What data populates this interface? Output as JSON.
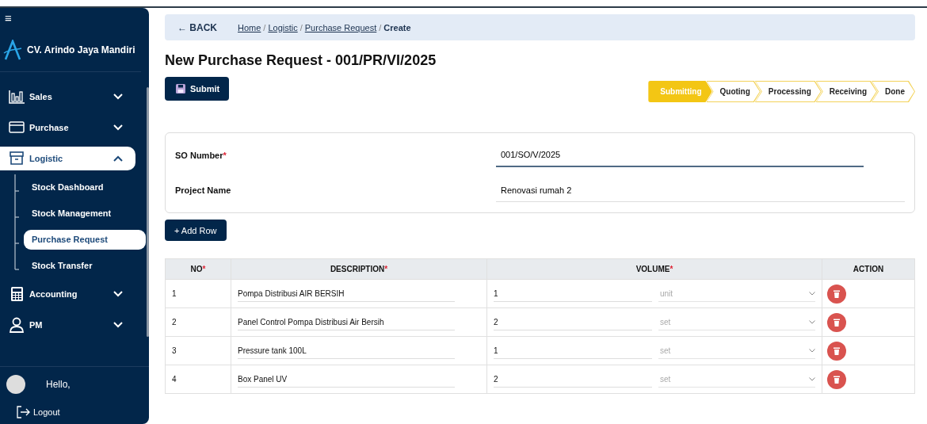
{
  "sidebar": {
    "menu_icon": "≡",
    "company": "CV. Arindo Jaya Mandiri",
    "items": [
      {
        "kind": "chart",
        "label": "Sales",
        "expanded": false
      },
      {
        "kind": "card",
        "label": "Purchase",
        "expanded": false
      },
      {
        "kind": "archive",
        "label": "Logistic",
        "expanded": true,
        "children": [
          {
            "label": "Stock Dashboard",
            "selected": false
          },
          {
            "label": "Stock Management",
            "selected": false
          },
          {
            "label": "Purchase Request",
            "selected": true
          },
          {
            "label": "Stock Transfer",
            "selected": false
          }
        ]
      },
      {
        "kind": "calculator",
        "label": "Accounting",
        "expanded": false
      },
      {
        "kind": "person",
        "label": "PM",
        "expanded": false
      }
    ],
    "greeting": "Hello,",
    "logout": "Logout"
  },
  "breadcrumb": {
    "back": "← BACK",
    "links": [
      "Home",
      "Logistic",
      "Purchase Request"
    ],
    "separator": "/",
    "current": "Create"
  },
  "title": "New Purchase Request - 001/PR/VI/2025",
  "submit": "Submit",
  "steps": [
    {
      "label": "Submitting",
      "selected": true
    },
    {
      "label": "Quoting",
      "selected": false
    },
    {
      "label": "Processing",
      "selected": false
    },
    {
      "label": "Receiving",
      "selected": false
    },
    {
      "label": "Done",
      "selected": false
    }
  ],
  "form": [
    {
      "label": "SO Number",
      "required": "*",
      "value": "001/SO/V/2025",
      "focused": true
    },
    {
      "label": "Project Name",
      "value": "Renovasi rumah 2",
      "focused": false
    }
  ],
  "add_row": "+ Add Row",
  "table": {
    "columns": [
      {
        "label": "NO",
        "required": "*"
      },
      {
        "label": "DESCRIPTION",
        "required": "*"
      },
      {
        "label": "VOLUME",
        "required": "*"
      },
      {
        "label": "ACTION"
      }
    ],
    "rows": [
      {
        "no": "1",
        "description": "Pompa Distribusi AIR BERSIH",
        "volume": "1",
        "unit": "unit"
      },
      {
        "no": "2",
        "description": "Panel Control Pompa Distribusi Air Bersih",
        "volume": "2",
        "unit": "set"
      },
      {
        "no": "3",
        "description": "Pressure tank 100L",
        "volume": "1",
        "unit": "set"
      },
      {
        "no": "4",
        "description": "Box Panel UV",
        "volume": "2",
        "unit": "set"
      }
    ]
  }
}
